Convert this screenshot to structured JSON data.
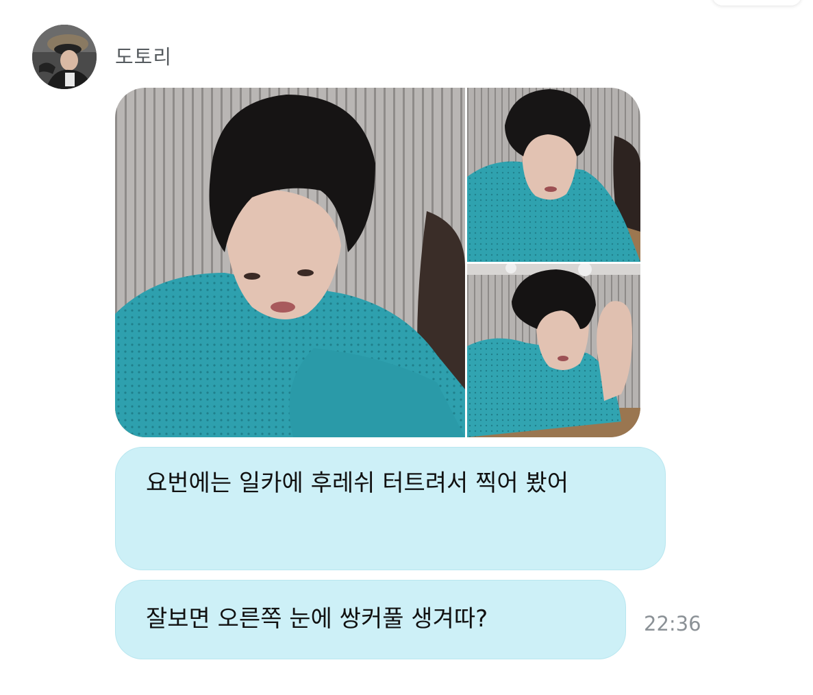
{
  "chat": {
    "sender_name": "도토리",
    "photos": [
      {
        "description_icon": "selfie-photo-main"
      },
      {
        "description_icon": "selfie-photo-top-right"
      },
      {
        "description_icon": "selfie-photo-bottom-right"
      }
    ],
    "messages": [
      {
        "text": "요번에는 일카에 후레쉬 터트려서 찍어 봤어"
      },
      {
        "text": "잘보면 오른쪽 눈에 쌍커풀 생겨따?"
      }
    ],
    "timestamp": "22:36"
  },
  "colors": {
    "bubble_bg": "#cdf0f7",
    "sweater": "#2fa0ad",
    "background": "#ffffff"
  }
}
